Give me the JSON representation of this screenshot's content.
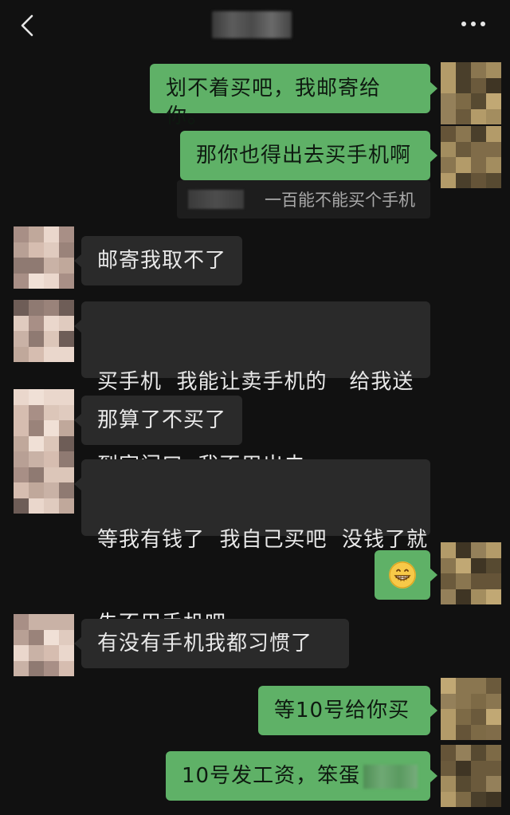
{
  "header": {
    "back_icon": "chevron-left-icon",
    "more_icon": "more-dots-icon"
  },
  "messages": [
    {
      "side": "self",
      "text": "划不着买吧，我邮寄给你。"
    },
    {
      "side": "self",
      "text": "那你也得出去买手机啊"
    },
    {
      "side": "quote",
      "text": "一百能不能买个手机"
    },
    {
      "side": "other",
      "text": "邮寄我取不了"
    },
    {
      "side": "other",
      "text_line1": "买手机  我能让卖手机的   给我送",
      "text_line2": "到家门口  我不用出去"
    },
    {
      "side": "other",
      "text": "那算了不买了"
    },
    {
      "side": "other",
      "text_line1": "等我有钱了  我自己买吧  没钱了就",
      "text_line2": "先不用手机吧"
    },
    {
      "side": "self",
      "emoji": "grinning-face-emoji"
    },
    {
      "side": "other",
      "text": "有没有手机我都习惯了"
    },
    {
      "side": "self",
      "text": "等10号给你买"
    },
    {
      "side": "self",
      "text": "10号发工资，笨蛋"
    }
  ],
  "colors": {
    "background": "#111111",
    "self_bubble": "#5fb167",
    "other_bubble": "#2a2a2a"
  }
}
